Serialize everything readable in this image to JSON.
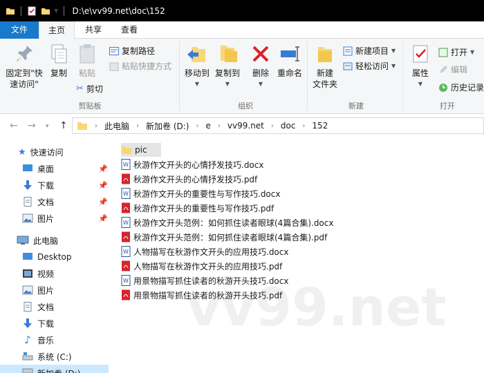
{
  "titlebar": {
    "path": "D:\\e\\vv99.net\\doc\\152"
  },
  "tabs": {
    "file": "文件",
    "home": "主页",
    "share": "共享",
    "view": "查看"
  },
  "ribbon": {
    "clipboard": {
      "pin_quick_access_line1": "固定到\"快",
      "pin_quick_access_line2": "速访问\"",
      "copy": "复制",
      "paste": "粘贴",
      "copy_path": "复制路径",
      "paste_shortcut": "粘贴快捷方式",
      "cut": "剪切",
      "group": "剪贴板"
    },
    "organize": {
      "move_to": "移动到",
      "copy_to": "复制到",
      "delete": "删除",
      "rename": "重命名",
      "group": "组织"
    },
    "new": {
      "new_folder_line1": "新建",
      "new_folder_line2": "文件夹",
      "new_item": "新建项目",
      "easy_access": "轻松访问",
      "group": "新建"
    },
    "open": {
      "properties": "属性",
      "open": "打开",
      "edit": "编辑",
      "history": "历史记录",
      "group": "打开"
    }
  },
  "breadcrumb": [
    "此电脑",
    "新加卷 (D:)",
    "e",
    "vv99.net",
    "doc",
    "152"
  ],
  "navpane": {
    "quick_access": "快速访问",
    "quick_items": [
      "桌面",
      "下载",
      "文档",
      "图片"
    ],
    "this_pc": "此电脑",
    "pc_items": [
      "Desktop",
      "视频",
      "图片",
      "文档",
      "下载",
      "音乐",
      "系统 (C:)",
      "新加卷 (D:)"
    ]
  },
  "files": [
    {
      "name": "pic",
      "type": "folder"
    },
    {
      "name": "秋游作文开头的心情抒发技巧.docx",
      "type": "docx"
    },
    {
      "name": "秋游作文开头的心情抒发技巧.pdf",
      "type": "pdf"
    },
    {
      "name": "秋游作文开头的重要性与写作技巧.docx",
      "type": "docx"
    },
    {
      "name": "秋游作文开头的重要性与写作技巧.pdf",
      "type": "pdf"
    },
    {
      "name": "秋游作文开头范例：如何抓住读者眼球(4篇合集).docx",
      "type": "docx"
    },
    {
      "name": "秋游作文开头范例：如何抓住读者眼球(4篇合集).pdf",
      "type": "pdf"
    },
    {
      "name": "人物描写在秋游作文开头的应用技巧.docx",
      "type": "docx"
    },
    {
      "name": "人物描写在秋游作文开头的应用技巧.pdf",
      "type": "pdf"
    },
    {
      "name": "用景物描写抓住读者的秋游开头技巧.docx",
      "type": "docx"
    },
    {
      "name": "用景物描写抓住读者的秋游开头技巧.pdf",
      "type": "pdf"
    }
  ],
  "watermark": "vv99.net",
  "colors": {
    "accent": "#1979ca",
    "folder": "#f8d775",
    "pdf": "#d8232a",
    "word": "#2b579a",
    "selected_nav": "#cce8ff"
  }
}
